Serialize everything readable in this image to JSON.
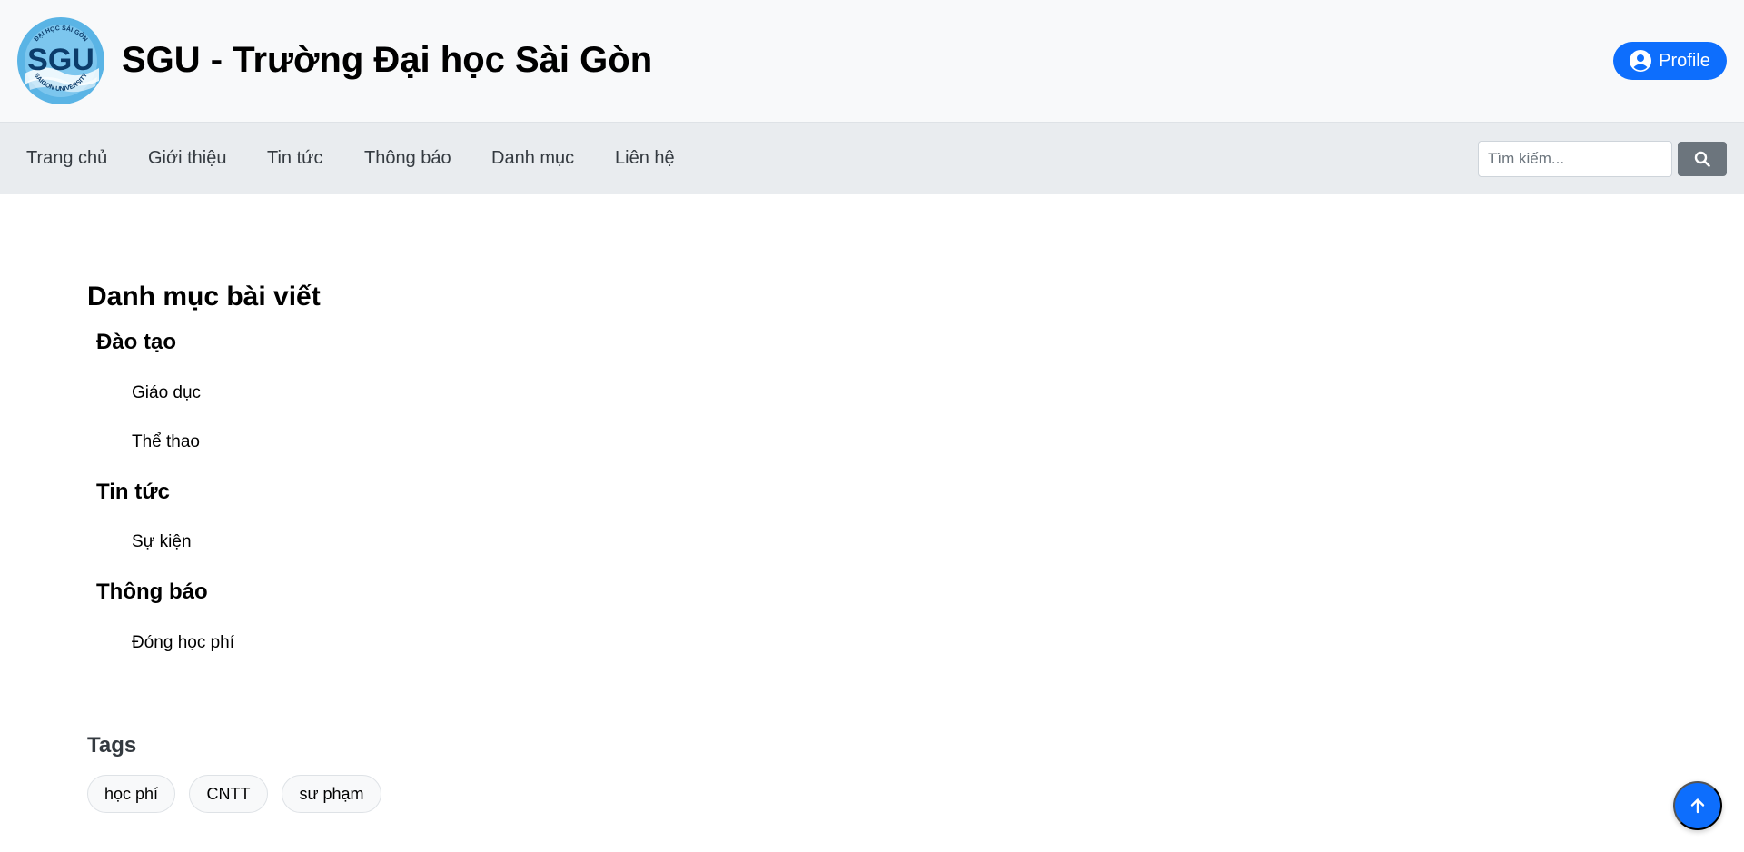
{
  "header": {
    "site_title": "SGU - Trường Đại học Sài Gòn",
    "profile_label": "Profile",
    "logo": {
      "text": "SGU",
      "ring_top": "ĐẠI HỌC SÀI GÒN",
      "ring_bottom": "SAIGON UNIVERSITY"
    }
  },
  "nav": {
    "items": [
      {
        "label": "Trang chủ"
      },
      {
        "label": "Giới thiệu"
      },
      {
        "label": "Tin tức"
      },
      {
        "label": "Thông báo"
      },
      {
        "label": "Danh mục"
      },
      {
        "label": "Liên hệ"
      }
    ],
    "search_placeholder": "Tìm kiếm...",
    "search_icon": "search-icon"
  },
  "sidebar": {
    "title": "Danh mục bài viết",
    "categories": [
      {
        "label": "Đào tạo",
        "children": [
          {
            "label": "Giáo dục"
          },
          {
            "label": "Thể thao"
          }
        ]
      },
      {
        "label": "Tin tức",
        "children": [
          {
            "label": "Sự kiện"
          }
        ]
      },
      {
        "label": "Thông báo",
        "children": [
          {
            "label": "Đóng học phí"
          }
        ]
      }
    ],
    "tags_title": "Tags",
    "tags": [
      {
        "label": "học phí"
      },
      {
        "label": "CNTT"
      },
      {
        "label": "sư phạm"
      }
    ]
  },
  "colors": {
    "primary": "#0d6efd",
    "header_bg": "#f8f9fa",
    "nav_bg": "#e9ecef",
    "logo_blue": "#5ab4e5",
    "logo_dark": "#0b3c6b"
  },
  "back_to_top_icon": "arrow-up-icon"
}
